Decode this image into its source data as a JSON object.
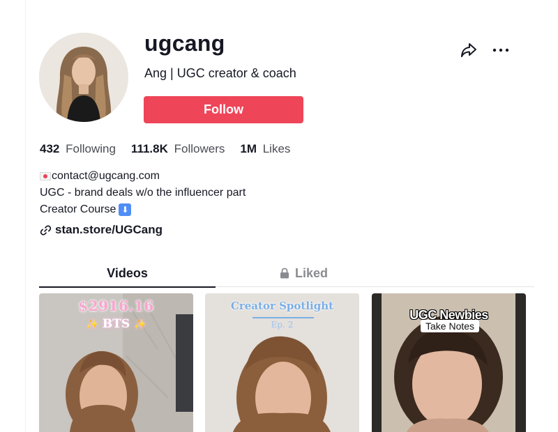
{
  "profile": {
    "username": "ugcang",
    "nickname": "Ang | UGC creator & coach",
    "follow_label": "Follow",
    "accent_color": "#ef4559"
  },
  "stats": [
    {
      "value": "432",
      "label": "Following"
    },
    {
      "value": "111.8K",
      "label": "Followers"
    },
    {
      "value": "1M",
      "label": "Likes"
    }
  ],
  "bio": {
    "line1": "contact@ugcang.com",
    "line1_emoji": "love-letter-emoji",
    "line2": "UGC - brand deals w/o the influencer part",
    "line3": "Creator Course",
    "line3_emoji": "down-arrow-emoji"
  },
  "link": {
    "text": "stan.store/UGCang",
    "icon": "link-icon"
  },
  "tabs": [
    {
      "label": "Videos",
      "active": true
    },
    {
      "label": "Liked",
      "active": false,
      "icon": "lock-icon"
    }
  ],
  "videos": [
    {
      "caption_top": "$2916.16",
      "caption_bottom": "BTS"
    },
    {
      "caption_top": "Creator Spotlight",
      "caption_bottom": "Ep. 2"
    },
    {
      "caption_top": "UGC Newbies",
      "caption_bottom": "Take Notes"
    }
  ],
  "icons": {
    "share": "share-icon",
    "more": "more-icon"
  }
}
